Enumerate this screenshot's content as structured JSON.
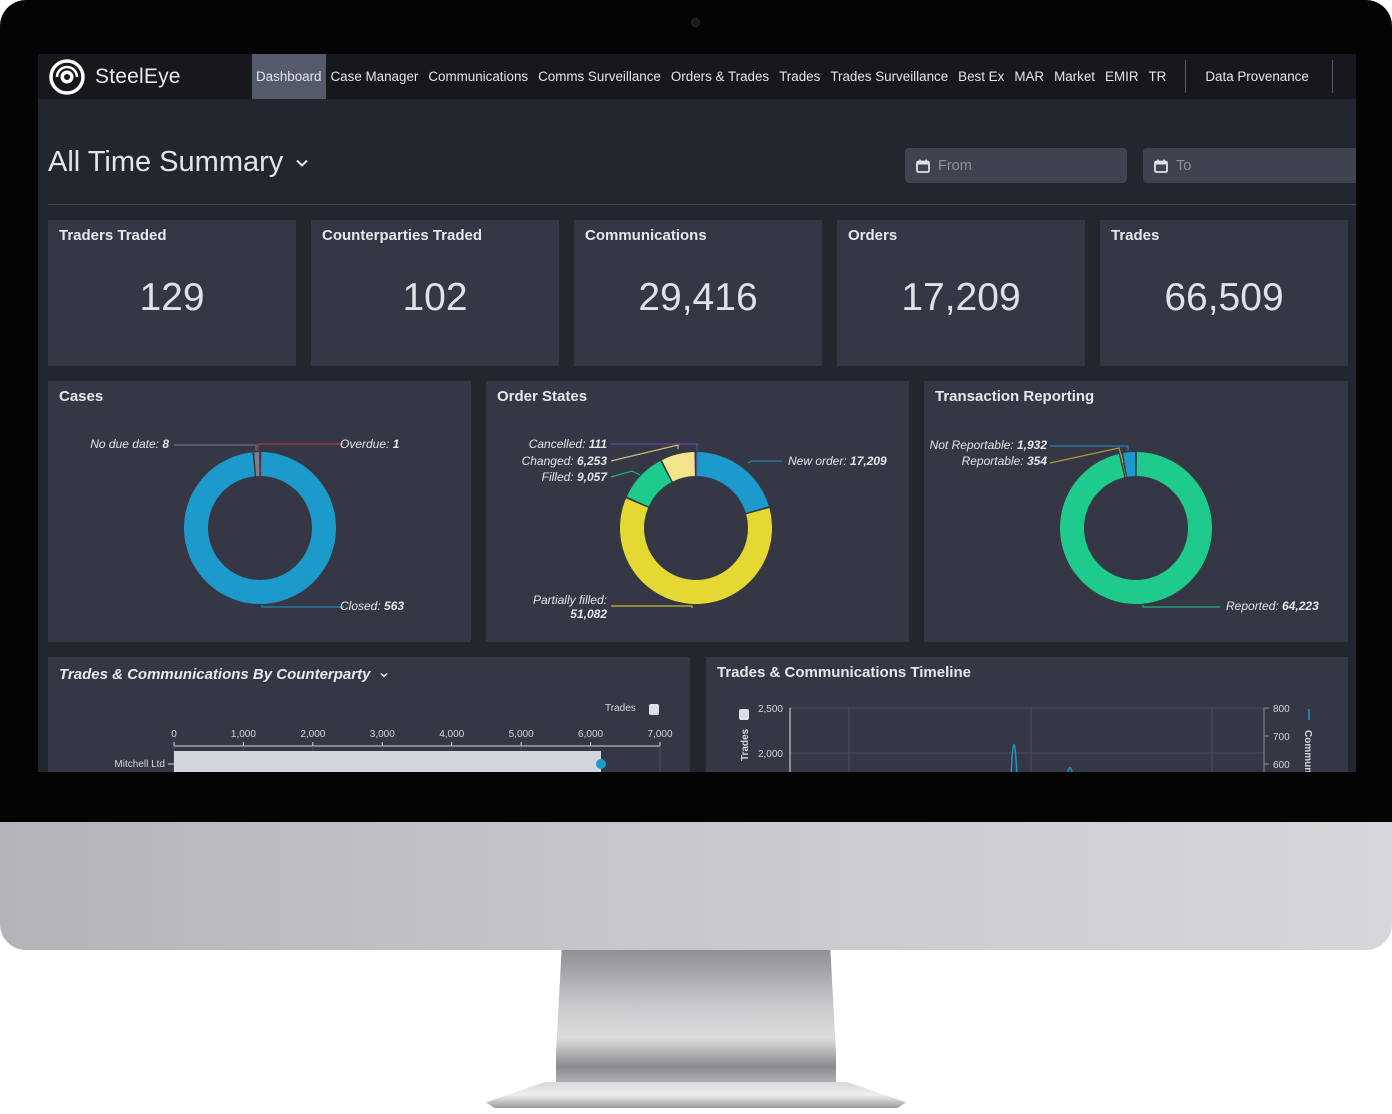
{
  "app": {
    "brand": "SteelEye",
    "logo_icon": "eye-logo-icon"
  },
  "nav": {
    "items": [
      {
        "label": "Dashboard",
        "active": true
      },
      {
        "label": "Case Manager"
      },
      {
        "label": "Communications"
      },
      {
        "label": "Comms Surveillance"
      },
      {
        "label": "Orders & Trades"
      },
      {
        "label": "Trades"
      },
      {
        "label": "Trades Surveillance"
      },
      {
        "label": "Best Ex"
      },
      {
        "label": "MAR"
      },
      {
        "label": "Market"
      },
      {
        "label": "EMIR"
      },
      {
        "label": "TR"
      }
    ],
    "extra": "Data Provenance"
  },
  "header": {
    "title": "All Time Summary",
    "from_placeholder": "From",
    "to_placeholder": "To"
  },
  "kpis": [
    {
      "label": "Traders Traded",
      "value": "129"
    },
    {
      "label": "Counterparties Traded",
      "value": "102"
    },
    {
      "label": "Communications",
      "value": "29,416"
    },
    {
      "label": "Orders",
      "value": "17,209"
    },
    {
      "label": "Trades",
      "value": "66,509"
    }
  ],
  "colors": {
    "blue": "#1b9acb",
    "green": "#1ecb8c",
    "yellow": "#e5d832",
    "pale_yellow": "#f2e48a",
    "purple": "#6b4fc0",
    "red": "#c43a4a",
    "grey": "#7a7f8e"
  },
  "chart_data": [
    {
      "type": "pie",
      "title": "Cases",
      "donut": true,
      "slices": [
        {
          "label": "Overdue",
          "value": 1,
          "display": "1",
          "color": "#c43a4a"
        },
        {
          "label": "Closed",
          "value": 563,
          "display": "563",
          "color": "#1b9acb"
        },
        {
          "label": "No due date",
          "value": 8,
          "display": "8",
          "color": "#7a7f8e"
        }
      ]
    },
    {
      "type": "pie",
      "title": "Order States",
      "donut": true,
      "slices": [
        {
          "label": "New order",
          "value": 17209,
          "display": "17,209",
          "color": "#1b9acb"
        },
        {
          "label": "Partially filled",
          "value": 51082,
          "display": "51,082",
          "color": "#e5d832"
        },
        {
          "label": "Filled",
          "value": 9057,
          "display": "9,057",
          "color": "#1ecb8c"
        },
        {
          "label": "Changed",
          "value": 6253,
          "display": "6,253",
          "color": "#f2e48a"
        },
        {
          "label": "Cancelled",
          "value": 111,
          "display": "111",
          "color": "#6b4fc0"
        }
      ]
    },
    {
      "type": "pie",
      "title": "Transaction Reporting",
      "donut": true,
      "slices": [
        {
          "label": "Reported",
          "value": 64223,
          "display": "64,223",
          "color": "#1ecb8c"
        },
        {
          "label": "Reportable",
          "value": 354,
          "display": "354",
          "color": "#c9b13a"
        },
        {
          "label": "Not Reportable",
          "value": 1932,
          "display": "1,932",
          "color": "#1b9acb"
        }
      ]
    },
    {
      "type": "bar",
      "title": "Trades & Communications By Counterparty",
      "orientation": "horizontal",
      "categories": [
        "Mitchell Ltd"
      ],
      "series": [
        {
          "name": "Trades",
          "values": [
            6150
          ],
          "color": "#d3d6de"
        }
      ],
      "marker_values": [
        6150
      ],
      "xlim": [
        0,
        7000
      ],
      "xticks": [
        "0",
        "1,000",
        "2,000",
        "3,000",
        "4,000",
        "5,000",
        "6,000",
        "7,000"
      ],
      "legend": "top-right"
    },
    {
      "type": "line",
      "title": "Trades & Communications Timeline",
      "ylabel": "Trades",
      "y2label": "Communi",
      "yticks": [
        "2,500",
        "2,000"
      ],
      "y2ticks": [
        "800",
        "700",
        "600"
      ],
      "series": [
        {
          "name": "Communications",
          "color": "#1b9acb",
          "peaks_y2": [
            720,
            610
          ]
        }
      ]
    }
  ]
}
